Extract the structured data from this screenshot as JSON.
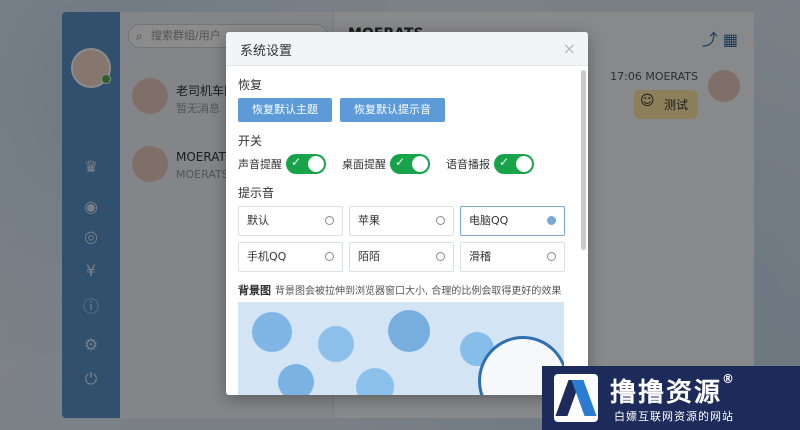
{
  "app": {
    "search_placeholder": "搜索群组/用户",
    "conversations": [
      {
        "name": "老司机车队",
        "last_message": "暂无消息"
      },
      {
        "name": "MOERATS",
        "last_message": "MOERATS: #"
      }
    ],
    "chat_title": "MOERATS",
    "bubble_time": "17:06",
    "bubble_sender": "MOERATS",
    "bubble_text": "测试"
  },
  "dialog": {
    "title": "系统设置",
    "close": "×",
    "restore_section": "恢复",
    "restore_buttons": [
      "恢复默认主题",
      "恢复默认提示音"
    ],
    "switch_section": "开关",
    "switches": [
      {
        "label": "声音提醒",
        "on": true
      },
      {
        "label": "桌面提醒",
        "on": true
      },
      {
        "label": "语音播报",
        "on": true
      }
    ],
    "tone_section": "提示音",
    "tones": [
      {
        "label": "默认",
        "selected": false
      },
      {
        "label": "苹果",
        "selected": false
      },
      {
        "label": "电脑QQ",
        "selected": true
      },
      {
        "label": "手机QQ",
        "selected": false
      },
      {
        "label": "陌陌",
        "selected": false
      },
      {
        "label": "滑稽",
        "selected": false
      }
    ],
    "bg_section": "背景图",
    "bg_hint": "背景图会被拉伸到浏览器窗口大小, 合理的比例会取得更好的效果"
  },
  "watermark": {
    "title": "撸撸资源",
    "registered": "®",
    "subtitle": "白嫖互联网资源的网站"
  },
  "icons": {
    "sidebar": [
      "crown-icon",
      "github-icon",
      "app-icon",
      "yen-icon",
      "info-icon",
      "settings-icon",
      "power-icon"
    ]
  },
  "colors": {
    "sidebar": "#5a93c8",
    "button": "#5c9bd8",
    "switch_on": "#16a34a",
    "selected": "#7aa7d6"
  }
}
